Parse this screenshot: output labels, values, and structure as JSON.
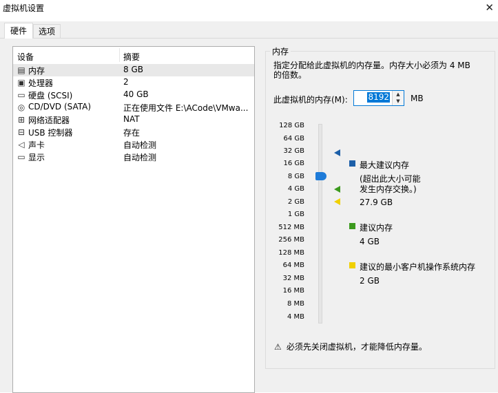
{
  "window": {
    "title": "虚拟机设置",
    "close_glyph": "✕"
  },
  "tabs": [
    {
      "label": "硬件"
    },
    {
      "label": "选项"
    }
  ],
  "devices": {
    "header": {
      "device": "设备",
      "summary": "摘要"
    },
    "rows": [
      {
        "name": "内存",
        "summary": "8 GB",
        "icon": "memory-icon",
        "glyph": "▤"
      },
      {
        "name": "处理器",
        "summary": "2",
        "icon": "processor-icon",
        "glyph": "▣"
      },
      {
        "name": "硬盘 (SCSI)",
        "summary": "40 GB",
        "icon": "hard-disk-icon",
        "glyph": "▭"
      },
      {
        "name": "CD/DVD (SATA)",
        "summary": "正在使用文件 E:\\ACode\\VMwa...",
        "icon": "cd-dvd-icon",
        "glyph": "◎"
      },
      {
        "name": "网络适配器",
        "summary": "NAT",
        "icon": "network-adapter-icon",
        "glyph": "⊞"
      },
      {
        "name": "USB 控制器",
        "summary": "存在",
        "icon": "usb-icon",
        "glyph": "⊟"
      },
      {
        "name": "声卡",
        "summary": "自动检测",
        "icon": "sound-card-icon",
        "glyph": "◁"
      },
      {
        "name": "显示",
        "summary": "自动检测",
        "icon": "display-icon",
        "glyph": "▭"
      }
    ]
  },
  "memory": {
    "group_title": "内存",
    "description": "指定分配给此虚拟机的内存量。内存大小必须为 4 MB 的倍数。",
    "field_label": "此虚拟机的内存(M):",
    "value": "8192",
    "unit": "MB",
    "scale": [
      "128 GB",
      "64 GB",
      "32 GB",
      "16 GB",
      "8 GB",
      "4 GB",
      "2 GB",
      "1 GB",
      "512 MB",
      "256 MB",
      "128 MB",
      "64 MB",
      "32 MB",
      "16 MB",
      "8 MB",
      "4 MB"
    ],
    "legend": {
      "max_label": "最大建议内存",
      "max_note_1": "(超出此大小可能",
      "max_note_2": "发生内存交换。)",
      "max_value": "27.9 GB",
      "rec_label": "建议内存",
      "rec_value": "4 GB",
      "min_label": "建议的最小客户机操作系统内存",
      "min_value": "2 GB"
    },
    "warning": "必须先关闭虚拟机，才能降低内存量。"
  },
  "colors": {
    "accent": "#0078d7",
    "max_marker": "#1c5fa8",
    "recommended_marker": "#3c9a1e",
    "minimum_marker": "#f0d000"
  }
}
